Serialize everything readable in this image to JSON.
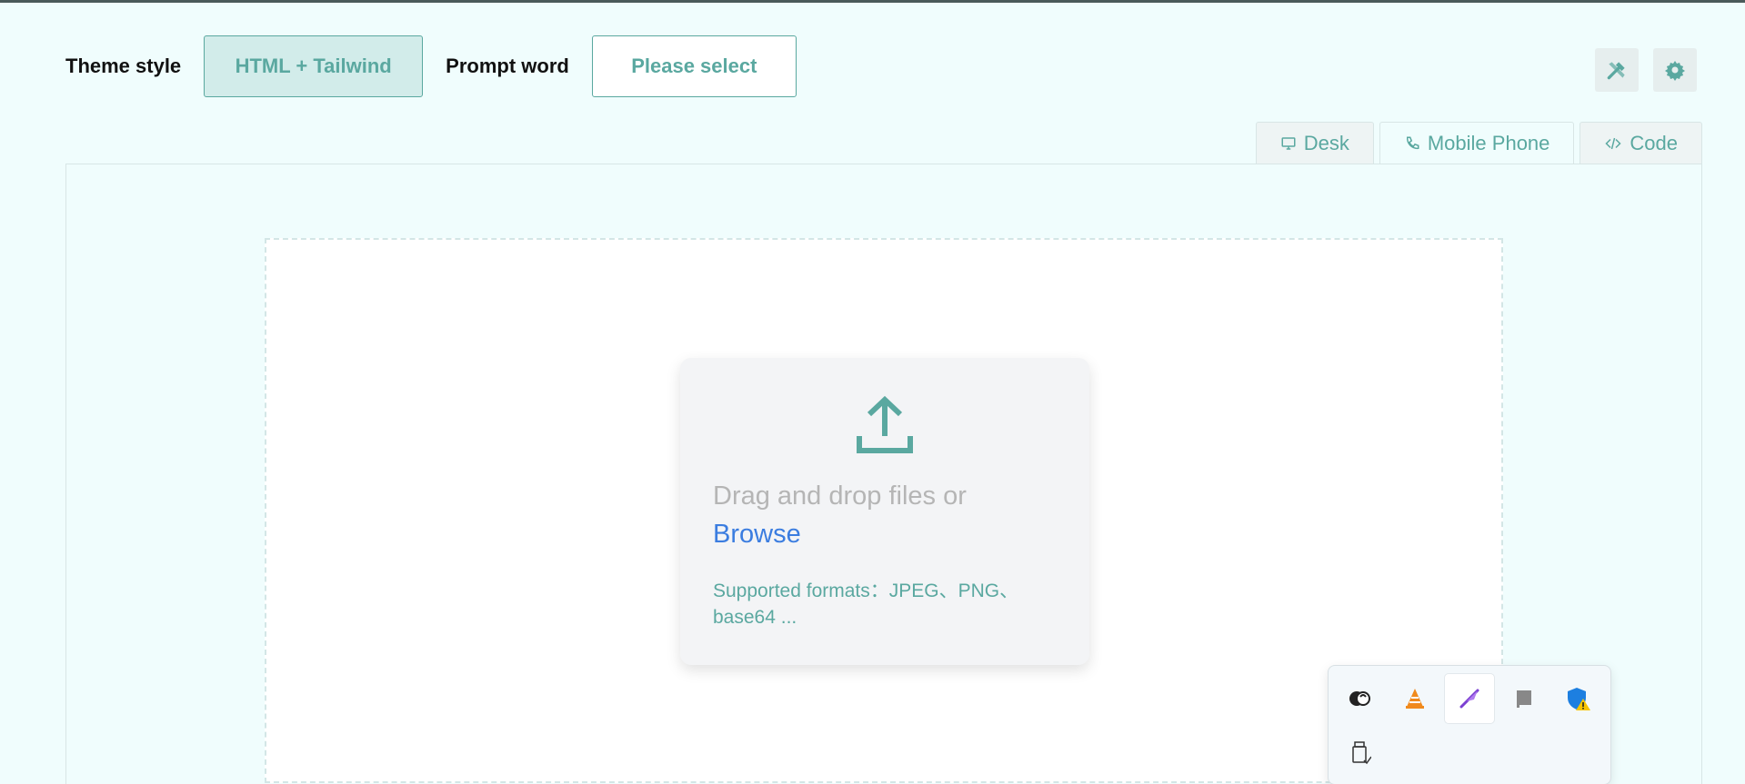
{
  "toolbar": {
    "theme_label": "Theme style",
    "theme_value": "HTML + Tailwind",
    "prompt_label": "Prompt word",
    "prompt_value": "Please select"
  },
  "tabs": [
    {
      "label": "Desk",
      "icon": "monitor-icon"
    },
    {
      "label": "Mobile Phone",
      "icon": "phone-icon"
    },
    {
      "label": "Code",
      "icon": "code-icon"
    }
  ],
  "upload": {
    "drag_text": "Drag and drop files or",
    "browse_text": "Browse",
    "formats_text": "Supported formats：JPEG、PNG、base64 ..."
  },
  "tray": {
    "icons": [
      "cloud-mask-icon",
      "vlc-cone-icon",
      "feather-pen-icon",
      "gray-square-icon",
      "shield-warning-icon",
      "usb-drive-icon"
    ]
  },
  "colors": {
    "accent": "#5aa8a0",
    "background": "#f0fdfd",
    "link": "#3b7de0"
  }
}
